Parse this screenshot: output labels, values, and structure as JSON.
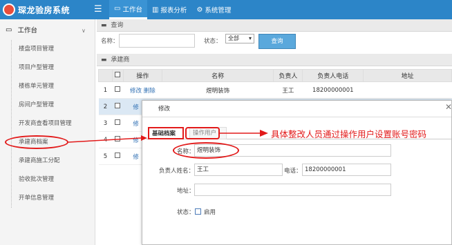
{
  "header": {
    "app_title": "琛龙验房系统",
    "nav": [
      {
        "label": "工作台",
        "icon": "monitor-icon"
      },
      {
        "label": "报表分析",
        "icon": "bar-chart-icon"
      },
      {
        "label": "系统管理",
        "icon": "gear-icon"
      }
    ]
  },
  "sidebar": {
    "section": "工作台",
    "items": [
      {
        "label": "楼盘项目管理"
      },
      {
        "label": "项目户型管理"
      },
      {
        "label": "楼栋单元管理"
      },
      {
        "label": "房间户型管理"
      },
      {
        "label": "开发商查看项目管理"
      },
      {
        "label": "承建商档案"
      },
      {
        "label": "承建商施工分配"
      },
      {
        "label": "验收批次管理"
      },
      {
        "label": "开单信息管理"
      }
    ]
  },
  "query": {
    "title": "查询",
    "name_label": "名称：",
    "status_label": "状态：",
    "status_value": "全部",
    "query_button": "查询"
  },
  "list": {
    "title": "承建商",
    "columns": [
      "操作",
      "名称",
      "负责人",
      "负责人电话",
      "地址"
    ],
    "rows": [
      {
        "no": "1",
        "edit": "修改",
        "delete": "删除",
        "name": "煜明装饰",
        "owner": "王工",
        "phone": "18200000001",
        "address": ""
      },
      {
        "no": "2",
        "edit": "修",
        "delete": "",
        "name": "",
        "owner": "",
        "phone": "",
        "address": ""
      },
      {
        "no": "3",
        "edit": "修",
        "delete": "",
        "name": "",
        "owner": "",
        "phone": "",
        "address": ""
      },
      {
        "no": "4",
        "edit": "修",
        "delete": "",
        "name": "",
        "owner": "",
        "phone": "",
        "address": ""
      },
      {
        "no": "5",
        "edit": "修",
        "delete": "",
        "name": "",
        "owner": "",
        "phone": "",
        "address": ""
      }
    ]
  },
  "modal": {
    "title": "修改",
    "tabs": [
      "基础档案",
      "操作用户"
    ],
    "name_label": "名称：",
    "name_value": "煜明装饰",
    "owner_label": "负责人姓名：",
    "owner_value": "王工",
    "phone_label": "电话：",
    "phone_value": "18200000001",
    "address_label": "地址：",
    "address_value": "",
    "status_label": "状态：",
    "enable_label": "启用"
  },
  "annotation": {
    "text": "具体整改人员通过操作用户设置账号密码",
    "color": "#e21a1a"
  }
}
